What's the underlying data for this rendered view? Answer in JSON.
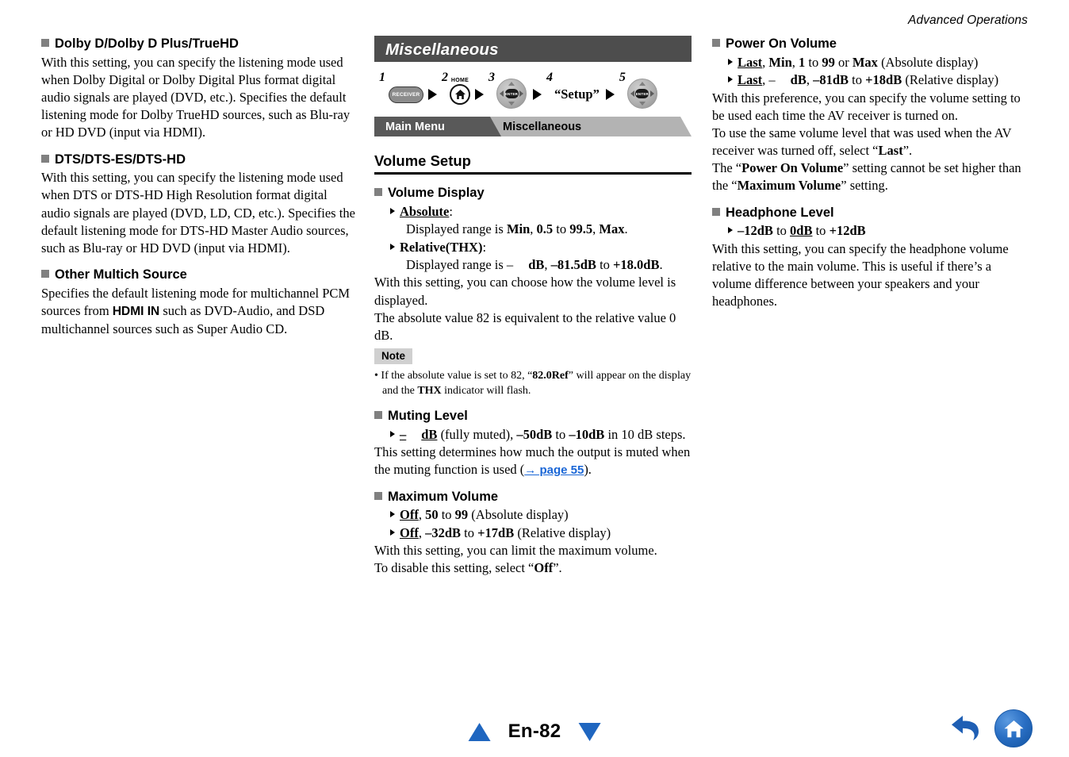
{
  "running_header": "Advanced Operations",
  "left_column": {
    "sections": [
      {
        "heading": "Dolby D/Dolby D Plus/TrueHD",
        "paragraph_1": "With this setting, you can specify the listening mode used when Dolby Digital or Dolby Digital Plus format digital audio signals are played (DVD, etc.). Specifies the default listening mode for Dolby TrueHD sources, such as Blu-ray or HD DVD (input via HDMI)."
      },
      {
        "heading": "DTS/DTS-ES/DTS-HD",
        "paragraph_1": "With this setting, you can specify the listening mode used when DTS or DTS-HD High Resolution format digital audio signals are played (DVD, LD, CD, etc.). Specifies the default listening mode for DTS-HD Master Audio sources, such as Blu-ray or HD DVD (input via HDMI)."
      },
      {
        "heading": "Other Multich Source",
        "paragraph_a": "Specifies the default listening mode for multichannel PCM sources from ",
        "paragraph_b": "HDMI IN",
        "paragraph_c": " such as DVD-Audio, and DSD multichannel sources such as Super Audio CD."
      }
    ]
  },
  "middle_column": {
    "title_bar": "Miscellaneous",
    "steps": [
      {
        "number": "1",
        "key_label": "RECEIVER"
      },
      {
        "number": "2",
        "key_label": "HOME"
      },
      {
        "number": "3",
        "key_label": "ENTER"
      },
      {
        "number": "4",
        "key_label": "“Setup”"
      },
      {
        "number": "5",
        "key_label": "ENTER"
      }
    ],
    "breadcrumb": {
      "parent": "Main Menu",
      "current": "Miscellaneous"
    },
    "section_heading": "Volume Setup",
    "volume_display": {
      "heading": "Volume Display",
      "option_1_label": "Absolute",
      "option_1_colon": ":",
      "option_1_detail_pre": "Displayed range is ",
      "option_1_min": "Min",
      "option_1_sep1": ", ",
      "option_1_low": "0.5",
      "option_1_to": " to ",
      "option_1_high": "99.5",
      "option_1_sep2": ", ",
      "option_1_max": "Max",
      "option_1_end": ".",
      "option_2_label": "Relative(THX)",
      "option_2_colon": ":",
      "option_2_detail_pre": "Displayed range is –",
      "option_2_db": "dB",
      "option_2_sep": ", ",
      "option_2_low": "–81.5dB",
      "option_2_to": " to ",
      "option_2_high": "+18.0dB",
      "option_2_end": ".",
      "paragraph_1": "With this setting, you can choose how the volume level is displayed.",
      "paragraph_2": "The absolute value 82 is equivalent to the relative value 0 dB."
    },
    "note": {
      "tag": "Note",
      "bullet_pre": "• If the absolute value is set to 82, “",
      "bullet_bold_1": "82.0Ref",
      "bullet_mid": "” will appear on the display and the ",
      "bullet_bold_2": "THX",
      "bullet_end": " indicator will flash."
    },
    "muting_level": {
      "heading": "Muting Level",
      "option_pre": "–",
      "option_db": "dB",
      "option_mid": " (fully muted), ",
      "option_low": "–50dB",
      "option_to": " to ",
      "option_high": "–10dB",
      "option_end": " in 10 dB steps.",
      "paragraph_pre": "This setting determines how much the output is muted when the muting function is used (",
      "paragraph_link": "→ page 55",
      "paragraph_post": ")."
    },
    "maximum_volume": {
      "heading": "Maximum Volume",
      "option_1_off": "Off",
      "option_1_sep": ", ",
      "option_1_low": "50",
      "option_1_to": " to ",
      "option_1_high": "99",
      "option_1_mode": " (Absolute display)",
      "option_2_off": "Off",
      "option_2_sep": ", ",
      "option_2_low": "–32dB",
      "option_2_to": " to ",
      "option_2_high": "+17dB",
      "option_2_mode": " (Relative display)",
      "paragraph_1": "With this setting, you can limit the maximum volume.",
      "paragraph_2_pre": "To disable this setting, select “",
      "paragraph_2_bold": "Off",
      "paragraph_2_post": "”."
    }
  },
  "right_column": {
    "power_on_volume": {
      "heading": "Power On Volume",
      "option_1_last": "Last",
      "option_1_s1": ", ",
      "option_1_min": "Min",
      "option_1_s2": ", ",
      "option_1_low": "1",
      "option_1_to": " to ",
      "option_1_high": "99",
      "option_1_or": " or ",
      "option_1_max": "Max",
      "option_1_mode": " (Absolute display)",
      "option_2_last": "Last",
      "option_2_s1": ", –",
      "option_2_db": "dB",
      "option_2_s2": ", ",
      "option_2_low": "–81dB",
      "option_2_to": " to ",
      "option_2_high": "+18dB",
      "option_2_mode": " (Relative display)",
      "paragraph_1": "With this preference, you can specify the volume setting to be used each time the AV receiver is turned on.",
      "paragraph_2_pre": "To use the same volume level that was used when the AV receiver was turned off, select “",
      "paragraph_2_bold": "Last",
      "paragraph_2_post": "”.",
      "paragraph_3_pre": "The “",
      "paragraph_3_bold_1": "Power On Volume",
      "paragraph_3_mid": "” setting cannot be set higher than the “",
      "paragraph_3_bold_2": "Maximum Volume",
      "paragraph_3_post": "” setting."
    },
    "headphone_level": {
      "heading": "Headphone Level",
      "option_low": "–12dB",
      "option_to_1": " to ",
      "option_mid": "0dB",
      "option_to_2": " to ",
      "option_high": "+12dB",
      "paragraph_1": "With this setting, you can specify the headphone volume relative to the main volume. This is useful if there’s a volume difference between your speakers and your headphones."
    }
  },
  "footer": {
    "page_label": "En-82",
    "prev_icon": "triangle-up-icon",
    "next_icon": "triangle-down-icon",
    "back_icon": "back-arrow-icon",
    "home_icon": "home-icon"
  },
  "colors": {
    "link": "#1a66d6",
    "pager_blue": "#1f66c0",
    "title_bar_bg": "#4d4d4d",
    "crumb_parent_bg": "#595959",
    "crumb_current_bg": "#b3b3b3",
    "bullet_square": "#808080"
  }
}
